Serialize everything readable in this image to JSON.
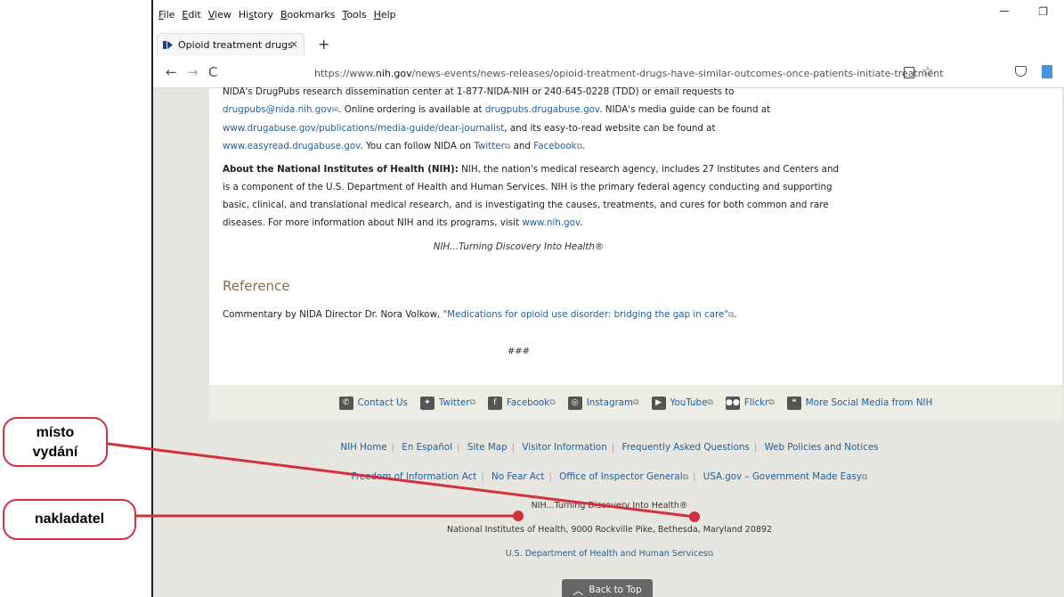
{
  "menu": {
    "items": [
      {
        "key": "F",
        "rest": "ile"
      },
      {
        "key": "E",
        "rest": "dit"
      },
      {
        "key": "V",
        "rest": "iew"
      },
      {
        "pre": "Hi",
        "key": "s",
        "rest": "tory"
      },
      {
        "key": "B",
        "rest": "ookmarks"
      },
      {
        "key": "T",
        "rest": "ools"
      },
      {
        "key": "H",
        "rest": "elp"
      }
    ],
    "file_pre": "",
    "file_key": "F",
    "file_rest": "ile",
    "edit_key": "E",
    "edit_rest": "dit",
    "view_key": "V",
    "view_rest": "iew",
    "history_pre": "Hi",
    "history_key": "s",
    "history_rest": "tory",
    "bookmarks_key": "B",
    "bookmarks_rest": "ookmarks",
    "tools_key": "T",
    "tools_rest": "ools",
    "help_key": "H",
    "help_rest": "elp"
  },
  "tab": {
    "title": "Opioid treatment drugs have sim",
    "close": "×",
    "new_tab": "+"
  },
  "nav": {
    "back": "←",
    "forward": "→",
    "reload": "C",
    "url_prefix": "https://www.",
    "url_domain": "nih.gov",
    "url_path": "/news-events/news-releases/opioid-treatment-drugs-have-similar-outcomes-once-patients-initiate-treatment",
    "star": "☆"
  },
  "content": {
    "p1_l1": "NIDA's DrugPubs research dissemination center at 1-877-NIDA-NIH or 240-645-0228 (TDD) or email requests to",
    "p1_email": "drugpubs@nida.nih.gov",
    "p1_t2": ". Online ordering is available at ",
    "p1_drugpubs": "drugpubs.drugabuse.gov",
    "p1_t3": ". NIDA's media guide can be found at",
    "p1_media": "www.drugabuse.gov/publications/media-guide/dear-journalist",
    "p1_t4": ", and its easy-to-read website can be found at",
    "p1_easy": "www.easyread.drugabuse.gov",
    "p1_t5": ". You can follow NIDA on ",
    "p1_twitter": "Twitter",
    "p1_t6": " and ",
    "p1_facebook": "Facebook",
    "p1_t7": ".",
    "p2_bold": "About the National Institutes of Health (NIH):",
    "p2_text": " NIH, the nation's medical research agency, includes 27 Institutes and Centers and is a component of the U.S. Department of Health and Human Services. NIH is the primary federal agency conducting and supporting basic, clinical, and translational medical research, and is investigating the causes, treatments, and cures for both common and rare diseases. For more information about NIH and its programs, visit ",
    "p2_link": "www.nih.gov",
    "p2_end": ".",
    "tagline": "NIH...Turning Discovery Into Health®",
    "ref_heading": "Reference",
    "ref_text": "Commentary by NIDA Director Dr. Nora Volkow, ",
    "ref_link": "\"Medications for opioid use disorder: bridging the gap in care\"",
    "ref_end": ".",
    "hashes": "###"
  },
  "social": {
    "contact": "Contact Us",
    "twitter": "Twitter",
    "facebook": "Facebook",
    "instagram": "Instagram",
    "youtube": "YouTube",
    "flickr": "Flickr",
    "more": "More Social Media from NIH"
  },
  "footer": {
    "links1": [
      "NIH Home",
      "En Español",
      "Site Map",
      "Visitor Information",
      "Frequently Asked Questions",
      "Web Policies and Notices"
    ],
    "links2": [
      "Freedom of Information Act",
      "No Fear Act",
      "Office of Inspector General",
      "USA.gov – Government Made Easy"
    ],
    "tagline": "NIH...Turning Discovery Into Health®",
    "address": "National Institutes of Health, 9000 Rockville Pike, Bethesda, Maryland 20892",
    "hhs": "U.S. Department of Health and Human Services",
    "back_to_top": "Back to Top"
  },
  "annotations": {
    "misto_line1": "místo",
    "misto_line2": "vydání",
    "nakladatel": "nakladatel",
    "color": "#d32f3f"
  },
  "colors": {
    "link": "#1f5f9c",
    "heading": "#8a6d3b",
    "page_bg": "#e6e5df"
  }
}
